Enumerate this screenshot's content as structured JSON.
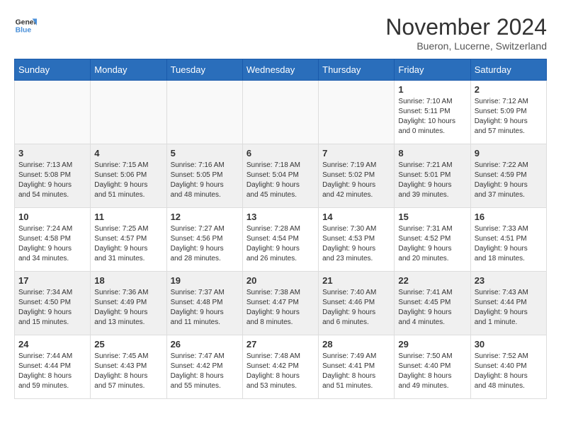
{
  "logo": {
    "line1": "General",
    "line2": "Blue"
  },
  "title": "November 2024",
  "subtitle": "Bueron, Lucerne, Switzerland",
  "days_header": [
    "Sunday",
    "Monday",
    "Tuesday",
    "Wednesday",
    "Thursday",
    "Friday",
    "Saturday"
  ],
  "weeks": [
    [
      {
        "num": "",
        "info": ""
      },
      {
        "num": "",
        "info": ""
      },
      {
        "num": "",
        "info": ""
      },
      {
        "num": "",
        "info": ""
      },
      {
        "num": "",
        "info": ""
      },
      {
        "num": "1",
        "info": "Sunrise: 7:10 AM\nSunset: 5:11 PM\nDaylight: 10 hours\nand 0 minutes."
      },
      {
        "num": "2",
        "info": "Sunrise: 7:12 AM\nSunset: 5:09 PM\nDaylight: 9 hours\nand 57 minutes."
      }
    ],
    [
      {
        "num": "3",
        "info": "Sunrise: 7:13 AM\nSunset: 5:08 PM\nDaylight: 9 hours\nand 54 minutes."
      },
      {
        "num": "4",
        "info": "Sunrise: 7:15 AM\nSunset: 5:06 PM\nDaylight: 9 hours\nand 51 minutes."
      },
      {
        "num": "5",
        "info": "Sunrise: 7:16 AM\nSunset: 5:05 PM\nDaylight: 9 hours\nand 48 minutes."
      },
      {
        "num": "6",
        "info": "Sunrise: 7:18 AM\nSunset: 5:04 PM\nDaylight: 9 hours\nand 45 minutes."
      },
      {
        "num": "7",
        "info": "Sunrise: 7:19 AM\nSunset: 5:02 PM\nDaylight: 9 hours\nand 42 minutes."
      },
      {
        "num": "8",
        "info": "Sunrise: 7:21 AM\nSunset: 5:01 PM\nDaylight: 9 hours\nand 39 minutes."
      },
      {
        "num": "9",
        "info": "Sunrise: 7:22 AM\nSunset: 4:59 PM\nDaylight: 9 hours\nand 37 minutes."
      }
    ],
    [
      {
        "num": "10",
        "info": "Sunrise: 7:24 AM\nSunset: 4:58 PM\nDaylight: 9 hours\nand 34 minutes."
      },
      {
        "num": "11",
        "info": "Sunrise: 7:25 AM\nSunset: 4:57 PM\nDaylight: 9 hours\nand 31 minutes."
      },
      {
        "num": "12",
        "info": "Sunrise: 7:27 AM\nSunset: 4:56 PM\nDaylight: 9 hours\nand 28 minutes."
      },
      {
        "num": "13",
        "info": "Sunrise: 7:28 AM\nSunset: 4:54 PM\nDaylight: 9 hours\nand 26 minutes."
      },
      {
        "num": "14",
        "info": "Sunrise: 7:30 AM\nSunset: 4:53 PM\nDaylight: 9 hours\nand 23 minutes."
      },
      {
        "num": "15",
        "info": "Sunrise: 7:31 AM\nSunset: 4:52 PM\nDaylight: 9 hours\nand 20 minutes."
      },
      {
        "num": "16",
        "info": "Sunrise: 7:33 AM\nSunset: 4:51 PM\nDaylight: 9 hours\nand 18 minutes."
      }
    ],
    [
      {
        "num": "17",
        "info": "Sunrise: 7:34 AM\nSunset: 4:50 PM\nDaylight: 9 hours\nand 15 minutes."
      },
      {
        "num": "18",
        "info": "Sunrise: 7:36 AM\nSunset: 4:49 PM\nDaylight: 9 hours\nand 13 minutes."
      },
      {
        "num": "19",
        "info": "Sunrise: 7:37 AM\nSunset: 4:48 PM\nDaylight: 9 hours\nand 11 minutes."
      },
      {
        "num": "20",
        "info": "Sunrise: 7:38 AM\nSunset: 4:47 PM\nDaylight: 9 hours\nand 8 minutes."
      },
      {
        "num": "21",
        "info": "Sunrise: 7:40 AM\nSunset: 4:46 PM\nDaylight: 9 hours\nand 6 minutes."
      },
      {
        "num": "22",
        "info": "Sunrise: 7:41 AM\nSunset: 4:45 PM\nDaylight: 9 hours\nand 4 minutes."
      },
      {
        "num": "23",
        "info": "Sunrise: 7:43 AM\nSunset: 4:44 PM\nDaylight: 9 hours\nand 1 minute."
      }
    ],
    [
      {
        "num": "24",
        "info": "Sunrise: 7:44 AM\nSunset: 4:44 PM\nDaylight: 8 hours\nand 59 minutes."
      },
      {
        "num": "25",
        "info": "Sunrise: 7:45 AM\nSunset: 4:43 PM\nDaylight: 8 hours\nand 57 minutes."
      },
      {
        "num": "26",
        "info": "Sunrise: 7:47 AM\nSunset: 4:42 PM\nDaylight: 8 hours\nand 55 minutes."
      },
      {
        "num": "27",
        "info": "Sunrise: 7:48 AM\nSunset: 4:42 PM\nDaylight: 8 hours\nand 53 minutes."
      },
      {
        "num": "28",
        "info": "Sunrise: 7:49 AM\nSunset: 4:41 PM\nDaylight: 8 hours\nand 51 minutes."
      },
      {
        "num": "29",
        "info": "Sunrise: 7:50 AM\nSunset: 4:40 PM\nDaylight: 8 hours\nand 49 minutes."
      },
      {
        "num": "30",
        "info": "Sunrise: 7:52 AM\nSunset: 4:40 PM\nDaylight: 8 hours\nand 48 minutes."
      }
    ]
  ]
}
